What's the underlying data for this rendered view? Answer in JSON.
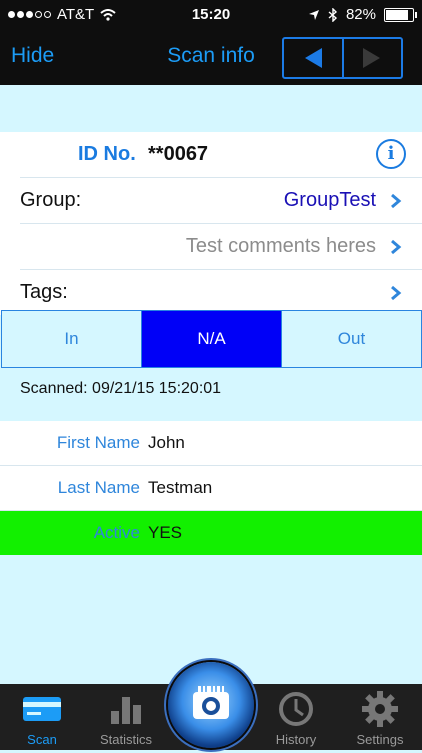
{
  "status": {
    "carrier": "AT&T",
    "time": "15:20",
    "battery": "82%",
    "battery_level": 0.82
  },
  "nav": {
    "hide": "Hide",
    "title": "Scan info"
  },
  "record": {
    "id_label": "ID No.",
    "id_value": "**0067",
    "group_label": "Group:",
    "group_value": "GroupTest",
    "comment": "Test comments heres",
    "tags_label": "Tags:"
  },
  "segment": {
    "in": "In",
    "na": "N/A",
    "out": "Out",
    "selected": "N/A",
    "selected_color": "#0000f7"
  },
  "scanned": "Scanned: 09/21/15 15:20:01",
  "fields": [
    {
      "label": "First Name",
      "value": "John"
    },
    {
      "label": "Last Name",
      "value": "Testman"
    },
    {
      "label": "Active",
      "value": "YES",
      "highlight": "#12f000"
    }
  ],
  "tabs": {
    "scan": "Scan",
    "statistics": "Statistics",
    "history": "History",
    "settings": "Settings",
    "active": "Scan"
  },
  "colors": {
    "accent": "#1c9cf6",
    "background": "#d5f7ff"
  }
}
